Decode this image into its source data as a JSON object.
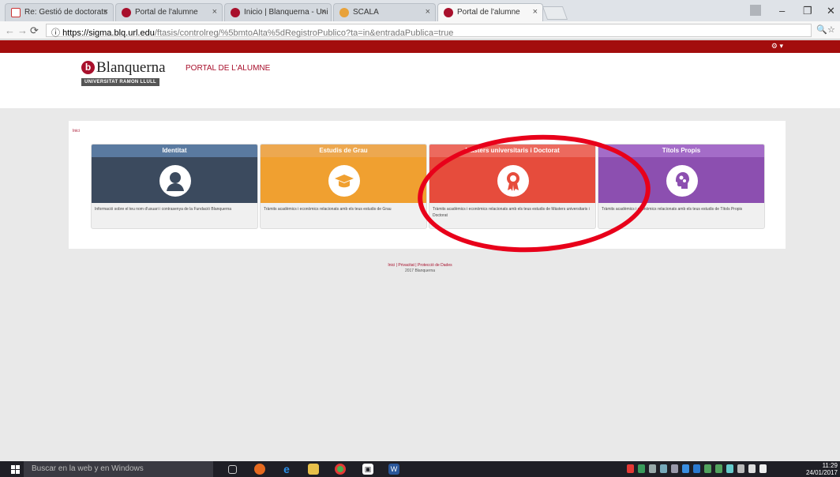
{
  "browser": {
    "tabs": [
      {
        "title": "Re: Gestió de doctorats",
        "icon": "gmail-icon"
      },
      {
        "title": "Portal de l'alumne",
        "icon": "blanquerna-icon"
      },
      {
        "title": "Inicio | Blanquerna - Uni",
        "icon": "blanquerna-icon"
      },
      {
        "title": "SCALA",
        "icon": "scala-icon"
      },
      {
        "title": "Portal de l'alumne",
        "icon": "blanquerna-icon"
      }
    ],
    "url_host": "https://sigma.blq.url.edu",
    "url_path": "/ftasis/controlreg/%5bmtoAlta%5dRegistroPublico?ta=in&entradaPublica=true"
  },
  "header": {
    "logo_letter": "b",
    "logo_name": "Blanquerna",
    "logo_sub": "UNIVERSITAT RAMON LLULL",
    "portal_title": "PORTAL DE L'ALUMNE"
  },
  "breadcrumb": "Inici",
  "cards": [
    {
      "title": "Identitat",
      "color": "#5a7aa0",
      "body_color": "#3b4a5e",
      "icon": "user-icon",
      "description": "Informació sobre el teu nom d'usuari i contrasenya de la Fundació Blanquerna"
    },
    {
      "title": "Estudis de Grau",
      "color": "#eda850",
      "body_color": "#f0a030",
      "icon": "graduation-cap-icon",
      "description": "Tràmits acadèmics i econòmics relacionats amb els teus estudis de Grau"
    },
    {
      "title": "Màsters universitaris i Doctorat",
      "color": "#ec6a5e",
      "body_color": "#e64c3c",
      "icon": "award-ribbon-icon",
      "description": "Tràmits acadèmics i econòmics relacionats amb els teus estudis de Màsters universitaris i Doctorat"
    },
    {
      "title": "Títols Propis",
      "color": "#a46cc8",
      "body_color": "#8c4fb0",
      "icon": "brain-gears-icon",
      "description": "Tràmits acadèmics i econòmics relacionats amb els teus estudis de Títols Propis"
    }
  ],
  "footer": {
    "links": "Inici | Privacitat | Protecció de Dades",
    "copyright": "2017 Blanquerna"
  },
  "taskbar": {
    "search_placeholder": "Buscar en la web y en Windows",
    "time": "11:29",
    "date": "24/01/2017"
  }
}
